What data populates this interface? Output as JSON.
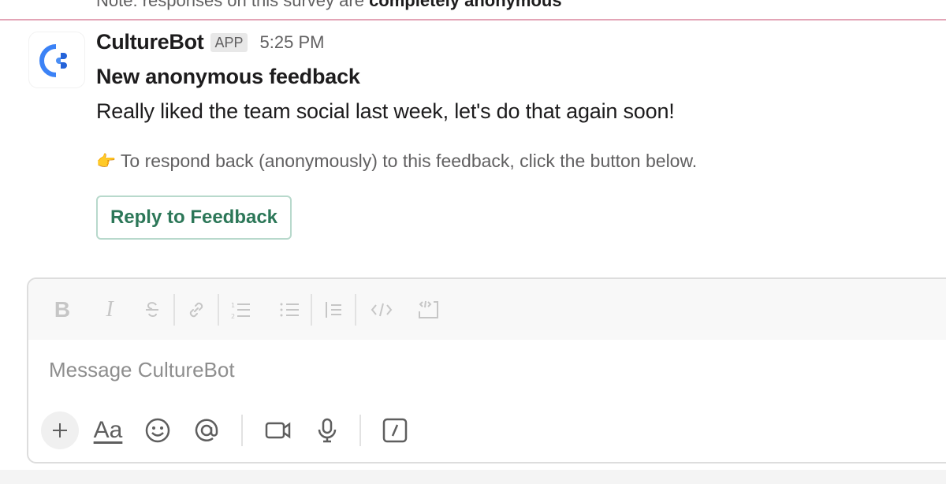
{
  "previous_message": {
    "note_prefix": "Note: responses on this survey are ",
    "note_bold": "completely anonymous"
  },
  "message": {
    "sender": "CultureBot",
    "badge": "APP",
    "time": "5:25 PM",
    "title": "New anonymous feedback",
    "body": "Really liked the team social last week, let's do that again soon!",
    "hint_emoji": "👉",
    "hint": "To respond back (anonymously) to this feedback, click the button below.",
    "button_label": "Reply to Feedback"
  },
  "composer": {
    "placeholder": "Message CultureBot",
    "format_tools": [
      "bold",
      "italic",
      "strikethrough",
      "link",
      "ordered-list",
      "bulleted-list",
      "blockquote",
      "code",
      "code-block"
    ],
    "action_tools": [
      "add",
      "formatting",
      "emoji",
      "mention",
      "video",
      "audio",
      "slash-command"
    ],
    "labels": {
      "bold": "B",
      "italic": "I",
      "formatting": "Aa"
    }
  },
  "colors": {
    "divider": "#e3a4b6",
    "button_text": "#2c7758",
    "button_border": "#b8d9cc",
    "logo_primary": "#3b82f6",
    "logo_dark": "#2563d9"
  }
}
